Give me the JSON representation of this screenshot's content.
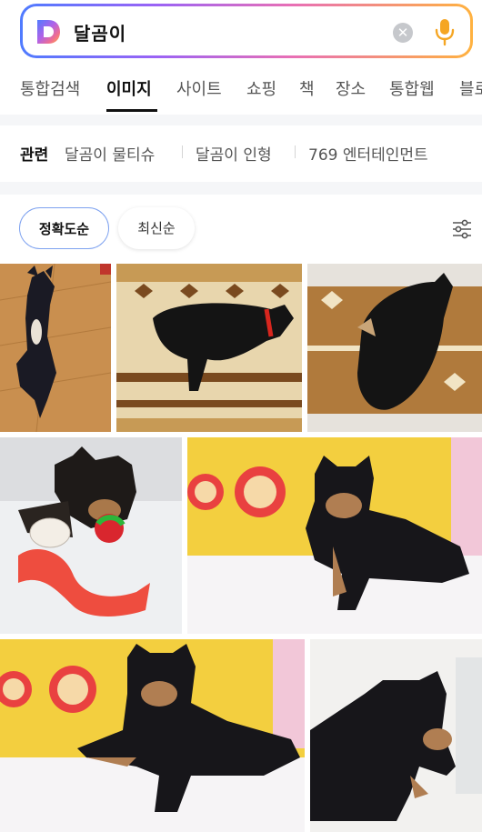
{
  "search": {
    "query": "달곰이",
    "logo_icon": "daum-logo-icon",
    "clear_icon": "clear-icon",
    "mic_icon": "mic-icon",
    "gradient_colors": [
      "#4f7bff",
      "#9a63f5",
      "#e86fb5",
      "#ffb23f"
    ]
  },
  "tabs": [
    {
      "label": "통합검색"
    },
    {
      "label": "이미지",
      "active": true
    },
    {
      "label": "사이트"
    },
    {
      "label": "쇼핑"
    },
    {
      "label": "책"
    },
    {
      "label": "장소"
    },
    {
      "label": "통합웹"
    },
    {
      "label": "블로"
    }
  ],
  "related": {
    "title": "관련",
    "items": [
      "달곰이 물티슈",
      "달곰이 인형",
      "769 엔터테인먼트"
    ]
  },
  "sort": {
    "options": [
      "정확도순",
      "최신순"
    ],
    "selected": "정확도순",
    "filter_icon": "filter-sliders-icon",
    "accent_color": "#7ea2f0"
  },
  "images": [
    {
      "subject": "black-dog-on-wood-floor"
    },
    {
      "subject": "black-dog-red-collar-on-blanket"
    },
    {
      "subject": "black-dog-curled-on-blanket"
    },
    {
      "subject": "puppy-with-red-toy"
    },
    {
      "subject": "puppy-on-yellow-bear-cushion"
    },
    {
      "subject": "puppy-on-yellow-bear-cushion-2"
    },
    {
      "subject": "puppy-side-view"
    }
  ]
}
